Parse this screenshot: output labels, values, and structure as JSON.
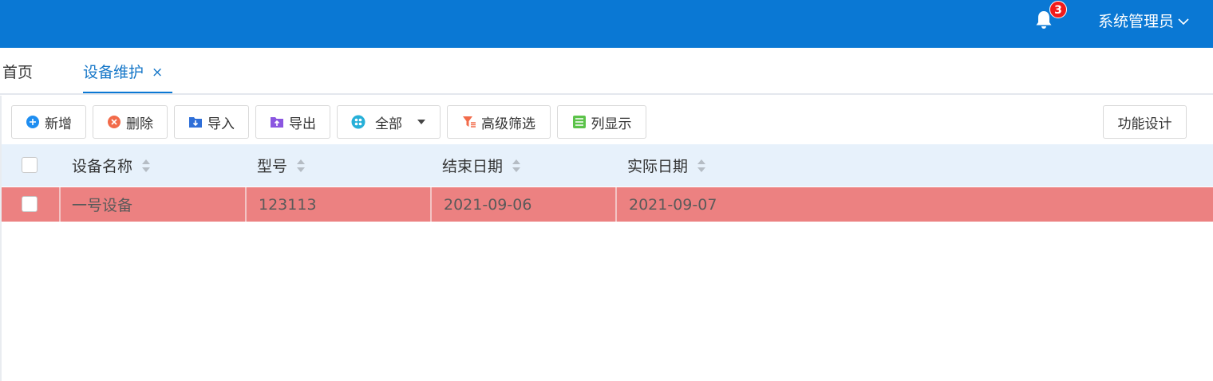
{
  "header": {
    "notification_count": "3",
    "user_name": "系统管理员",
    "bg_color": "#0a78d4",
    "icons": {
      "bell": "bell-icon",
      "chevron": "chevron-down-icon"
    }
  },
  "tabs": [
    {
      "label": "首页",
      "active": false
    },
    {
      "label": "设备维护",
      "active": true,
      "close": "×"
    }
  ],
  "toolbar": {
    "add": "新增",
    "delete": "删除",
    "import": "导入",
    "export": "导出",
    "filter_select": "全部",
    "advanced_filter": "高级筛选",
    "column_display": "列显示",
    "function_design": "功能设计"
  },
  "table": {
    "columns": [
      "设备名称",
      "型号",
      "结束日期",
      "实际日期"
    ],
    "rows": [
      {
        "name": "一号设备",
        "model": "123113",
        "end_date": "2021-09-06",
        "actual_date": "2021-09-07",
        "highlight": "#ec8181"
      }
    ]
  }
}
